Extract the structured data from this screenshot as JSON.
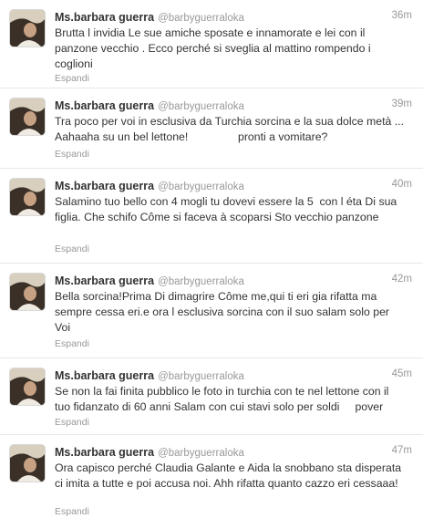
{
  "tweets": [
    {
      "name": "Ms.barbara guerra",
      "handle": "@barbyguerraloka",
      "time": "36m",
      "text": "Brutta l invidia Le sue amiche sposate e innamorate e lei con il panzone vecchio . Ecco perché si sveglia al mattino rompendo i coglioni",
      "expand": "Espandi"
    },
    {
      "name": "Ms.barbara guerra",
      "handle": "@barbyguerraloka",
      "time": "39m",
      "text": "Tra poco per voi in esclusiva da Turchia sorcina e la sua dolce metà ... Aahaaha su un bel lettone!                pronti a vomitare?",
      "expand": "Espandi"
    },
    {
      "name": "Ms.barbara guerra",
      "handle": "@barbyguerraloka",
      "time": "40m",
      "text": "Salamino tuo bello con 4 mogli tu dovevi essere la 5  con l éta Di sua figlia. Che schifo Côme si faceva à scoparsi Sto vecchio panzone",
      "expand": "Espandi"
    },
    {
      "name": "Ms.barbara guerra",
      "handle": "@barbyguerraloka",
      "time": "42m",
      "text": "Bella sorcina!Prima Di dimagrire Côme me,qui ti eri gia rifatta ma sempre cessa eri.e ora l esclusiva sorcina con il suo salam solo per Voi",
      "expand": "Espandi"
    },
    {
      "name": "Ms.barbara guerra",
      "handle": "@barbyguerraloka",
      "time": "45m",
      "text": "Se non la fai finita pubblico le foto in turchia con te nel lettone con il tuo fidanzato di 60 anni Salam con cui stavi solo per soldi     pover",
      "expand": "Espandi"
    },
    {
      "name": "Ms.barbara guerra",
      "handle": "@barbyguerraloka",
      "time": "47m",
      "text": "Ora capisco perché Claudia Galante e Aida la snobbano sta disperata ci imita a tutte e poi accusa noi. Ahh rifatta quanto cazzo eri cessaaa!",
      "expand": "Espandi"
    }
  ]
}
